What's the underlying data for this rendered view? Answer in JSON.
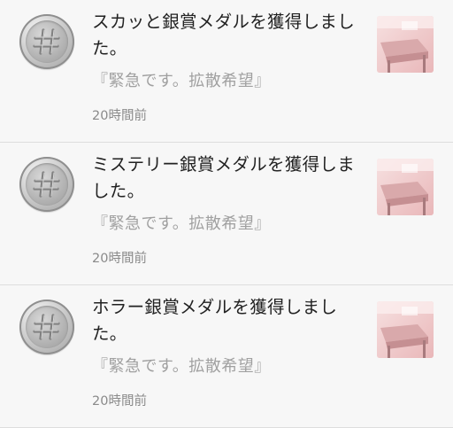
{
  "notifications": [
    {
      "title": "スカッと銀賞メダルを獲得しました。",
      "snippet": "『緊急です。拡散希望』",
      "time": "20時間前",
      "medal_icon": "hash-silver-medal-icon",
      "thumbnail": "classroom-thumbnail"
    },
    {
      "title": "ミステリー銀賞メダルを獲得しました。",
      "snippet": "『緊急です。拡散希望』",
      "time": "20時間前",
      "medal_icon": "hash-silver-medal-icon",
      "thumbnail": "classroom-thumbnail"
    },
    {
      "title": "ホラー銀賞メダルを獲得しました。",
      "snippet": "『緊急です。拡散希望』",
      "time": "20時間前",
      "medal_icon": "hash-silver-medal-icon",
      "thumbnail": "classroom-thumbnail"
    }
  ],
  "colors": {
    "background": "#f7f7f7",
    "title_text": "#222222",
    "snippet_text": "#a0a0a0",
    "time_text": "#8a8a8a",
    "divider": "#dddddd",
    "medal_silver": "#b3b3b3"
  }
}
